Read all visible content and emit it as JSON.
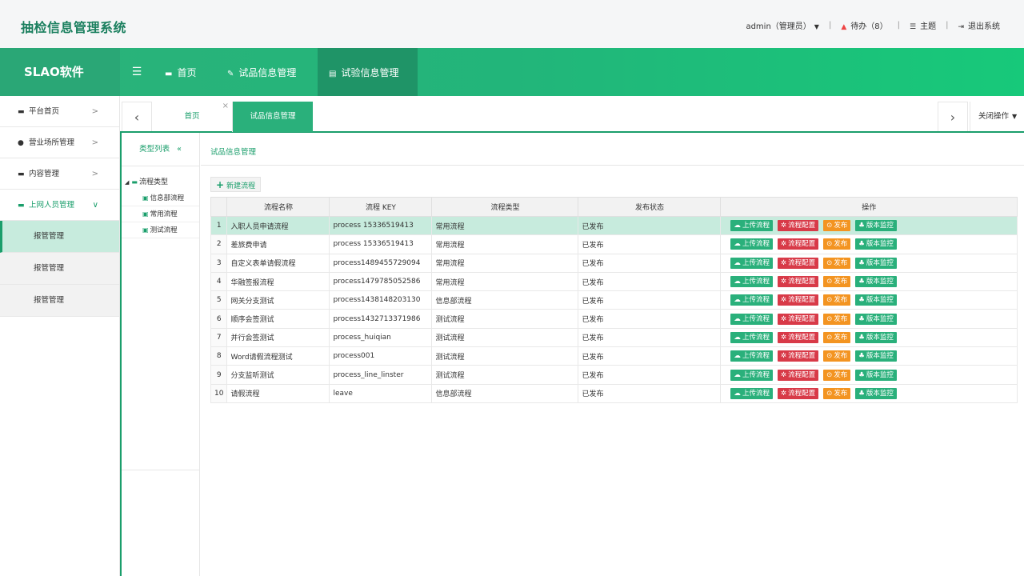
{
  "header": {
    "system_title": "抽检信息管理系统",
    "user": "admin（管理员）",
    "todo": "待办（8）",
    "theme": "主题",
    "logout": "退出系统"
  },
  "nav": {
    "brand": "SLAO软件",
    "items": [
      {
        "label": "首页",
        "icon": "monitor-icon"
      },
      {
        "label": "试品信息管理",
        "icon": "edit-icon"
      },
      {
        "label": "试验信息管理",
        "icon": "book-icon"
      }
    ]
  },
  "sidebar": {
    "items": [
      "平台首页",
      "营业场所管理",
      "内容管理",
      "上网人员管理"
    ],
    "sub_items": [
      "报管管理",
      "报管管理",
      "报管管理"
    ]
  },
  "tabs": {
    "home": "首页",
    "active": "试品信息管理",
    "close_ops": "关闭操作"
  },
  "type_panel": {
    "title": "类型列表",
    "root": "流程类型",
    "children": [
      "信息部流程",
      "常用流程",
      "测试流程"
    ]
  },
  "main": {
    "breadcrumb": "试品信息管理",
    "new_button": "新建流程"
  },
  "table": {
    "columns": [
      "流程名称",
      "流程 KEY",
      "流程类型",
      "发布状态",
      "操作"
    ],
    "ops": [
      "上传流程",
      "流程配置",
      "发布",
      "版本监控"
    ],
    "rows": [
      {
        "no": "1",
        "name": "入职人员申请流程",
        "key": "process 15336519413",
        "type": "常用流程",
        "status": "已发布"
      },
      {
        "no": "2",
        "name": "差旅费申请",
        "key": "process 15336519413",
        "type": "常用流程",
        "status": "已发布"
      },
      {
        "no": "3",
        "name": "自定义表单请假流程",
        "key": "process1489455729094",
        "type": "常用流程",
        "status": "已发布"
      },
      {
        "no": "4",
        "name": "华融签报流程",
        "key": "process1479785052586",
        "type": "常用流程",
        "status": "已发布"
      },
      {
        "no": "5",
        "name": "网关分支测试",
        "key": "process1438148203130",
        "type": "信息部流程",
        "status": "已发布"
      },
      {
        "no": "6",
        "name": "顺序会签测试",
        "key": "process1432713371986",
        "type": "测试流程",
        "status": "已发布"
      },
      {
        "no": "7",
        "name": "并行会签测试",
        "key": "process_huiqian",
        "type": "测试流程",
        "status": "已发布"
      },
      {
        "no": "8",
        "name": "Word请假流程测试",
        "key": "process001",
        "type": "测试流程",
        "status": "已发布"
      },
      {
        "no": "9",
        "name": "分支监听测试",
        "key": "process_line_linster",
        "type": "测试流程",
        "status": "已发布"
      },
      {
        "no": "10",
        "name": "请假流程",
        "key": "leave",
        "type": "信息部流程",
        "status": "已发布"
      }
    ]
  }
}
